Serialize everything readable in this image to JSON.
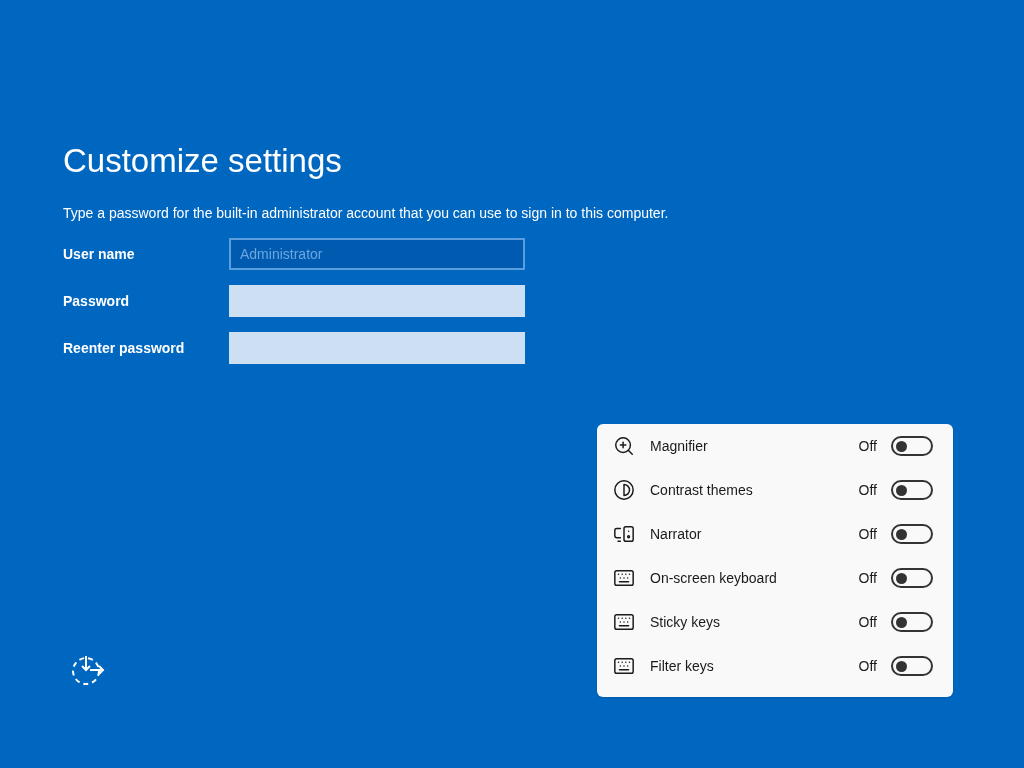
{
  "title": "Customize settings",
  "description": "Type a password for the built-in administrator account that you can use to sign in to this computer.",
  "fields": [
    {
      "label": "User name",
      "value": "Administrator",
      "disabled": true
    },
    {
      "label": "Password",
      "disabled": false
    },
    {
      "label": "Reenter password",
      "disabled": false
    }
  ],
  "accessibility_panel": {
    "items": [
      {
        "kind": "magnifier",
        "label": "Magnifier",
        "state_text": "Off",
        "on": false
      },
      {
        "kind": "contrast",
        "label": "Contrast themes",
        "state_text": "Off",
        "on": false
      },
      {
        "kind": "narrator",
        "label": "Narrator",
        "state_text": "Off",
        "on": false
      },
      {
        "kind": "keyboard",
        "label": "On-screen keyboard",
        "state_text": "Off",
        "on": false
      },
      {
        "kind": "sticky",
        "label": "Sticky keys",
        "state_text": "Off",
        "on": false
      },
      {
        "kind": "filter",
        "label": "Filter keys",
        "state_text": "Off",
        "on": false
      }
    ]
  }
}
